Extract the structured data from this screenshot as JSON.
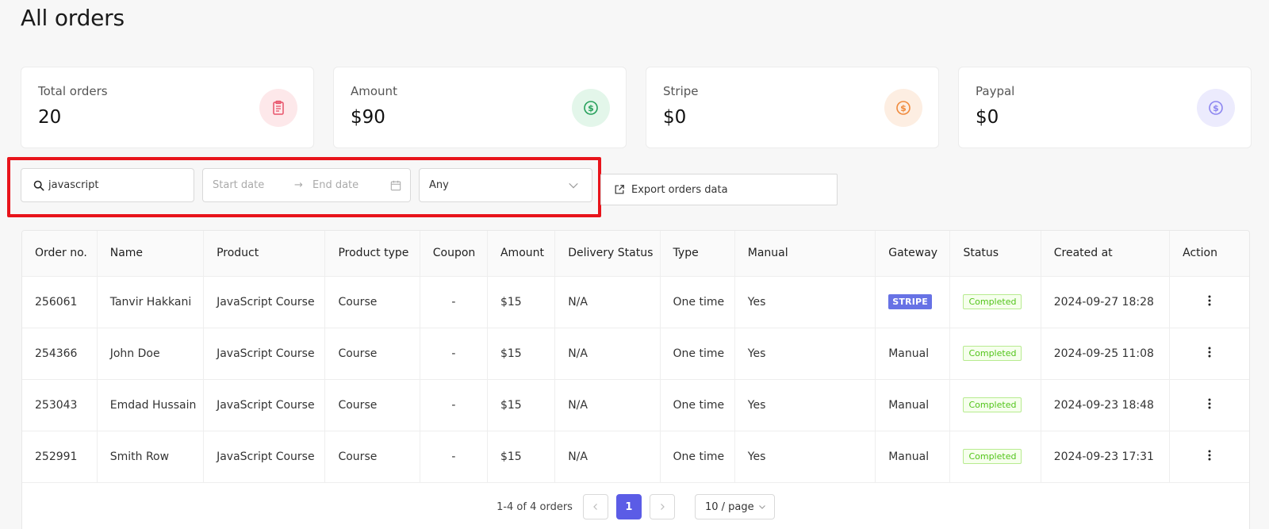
{
  "page": {
    "title": "All orders"
  },
  "stats": [
    {
      "label": "Total orders",
      "value": "20",
      "icon": "clipboard-icon",
      "color": "#e8536a",
      "bg": "#fde8ea"
    },
    {
      "label": "Amount",
      "value": "$90",
      "icon": "dollar-icon",
      "color": "#25a05a",
      "bg": "#e3f6ea"
    },
    {
      "label": "Stripe",
      "value": "$0",
      "icon": "dollar-icon",
      "color": "#f08a3c",
      "bg": "#fdeee2"
    },
    {
      "label": "Paypal",
      "value": "$0",
      "icon": "dollar-icon",
      "color": "#8c85f0",
      "bg": "#ecebfd"
    }
  ],
  "filters": {
    "search_value": "javascript",
    "start_placeholder": "Start date",
    "end_placeholder": "End date",
    "date_separator": "→",
    "status_selected": "Any",
    "export_label": "Export orders data"
  },
  "table": {
    "columns": [
      "Order no.",
      "Name",
      "Product",
      "Product type",
      "Coupon",
      "Amount",
      "Delivery Status",
      "Type",
      "Manual",
      "Gateway",
      "Status",
      "Created at",
      "Action"
    ],
    "rows": [
      {
        "order_no": "256061",
        "name": "Tanvir Hakkani",
        "product": "JavaScript Course",
        "product_type": "Course",
        "coupon": "-",
        "amount": "$15",
        "delivery": "N/A",
        "type": "One time",
        "manual": "Yes",
        "gateway": "STRIPE",
        "gateway_badge": true,
        "status": "Completed",
        "created": "2024-09-27 18:28"
      },
      {
        "order_no": "254366",
        "name": "John Doe",
        "product": "JavaScript Course",
        "product_type": "Course",
        "coupon": "-",
        "amount": "$15",
        "delivery": "N/A",
        "type": "One time",
        "manual": "Yes",
        "gateway": "Manual",
        "gateway_badge": false,
        "status": "Completed",
        "created": "2024-09-25 11:08"
      },
      {
        "order_no": "253043",
        "name": "Emdad Hussain",
        "product": "JavaScript Course",
        "product_type": "Course",
        "coupon": "-",
        "amount": "$15",
        "delivery": "N/A",
        "type": "One time",
        "manual": "Yes",
        "gateway": "Manual",
        "gateway_badge": false,
        "status": "Completed",
        "created": "2024-09-23 18:48"
      },
      {
        "order_no": "252991",
        "name": "Smith Row",
        "product": "JavaScript Course",
        "product_type": "Course",
        "coupon": "-",
        "amount": "$15",
        "delivery": "N/A",
        "type": "One time",
        "manual": "Yes",
        "gateway": "Manual",
        "gateway_badge": false,
        "status": "Completed",
        "created": "2024-09-23 17:31"
      }
    ]
  },
  "pagination": {
    "total_text": "1-4 of 4 orders",
    "current_page": "1",
    "page_size": "10 / page"
  },
  "colors": {
    "accent": "#5b5ce6",
    "highlight": "#e8141b",
    "stripe": "#6772e5",
    "status_green": "#52c41a"
  }
}
